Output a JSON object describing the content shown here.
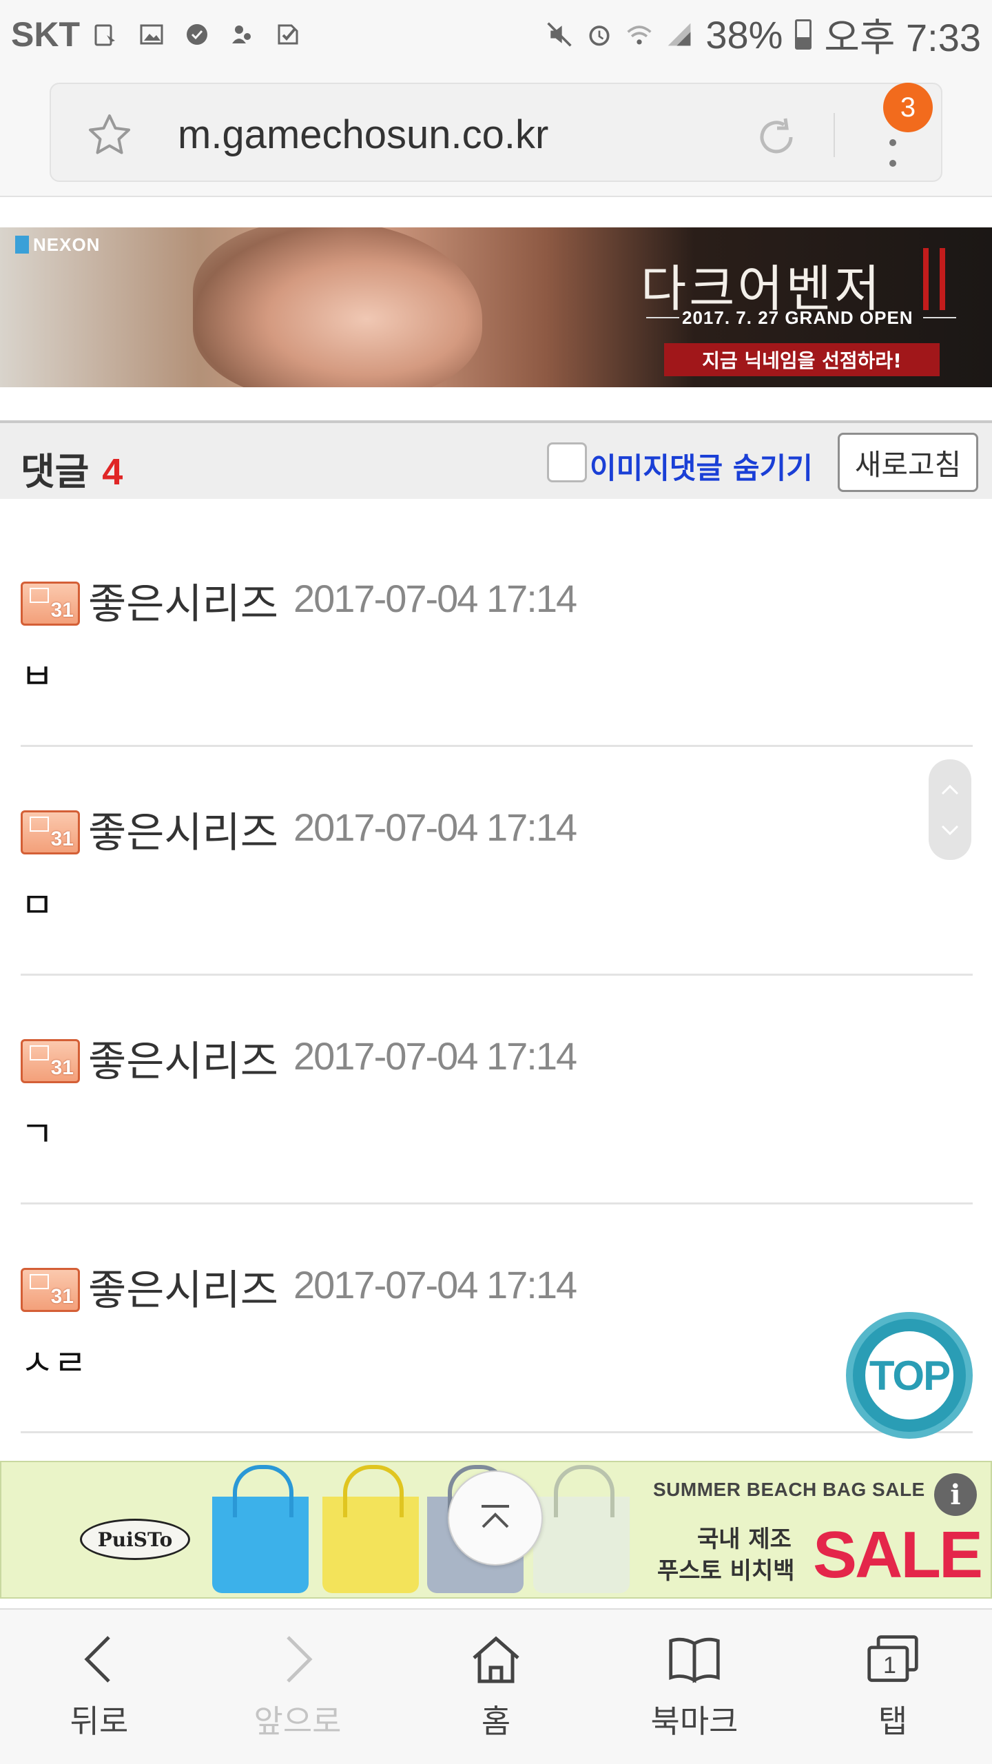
{
  "status_bar": {
    "carrier": "SKT",
    "battery": "38%",
    "time": "오후 7:33"
  },
  "browser": {
    "url": "m.gamechosun.co.kr",
    "tab_badge_count": "3"
  },
  "ad_top": {
    "brand": "NEXON",
    "title": "다크어벤저",
    "date": "2017. 7. 27 GRAND OPEN",
    "cta": "지금 닉네임을 선점하라!"
  },
  "comments_header": {
    "title": "댓글",
    "count": "4",
    "hide_images_label": "이미지댓글 숨기기",
    "hide_images_checked": false,
    "refresh_label": "새로고침"
  },
  "comments": [
    {
      "badge_number": "31",
      "author": "좋은시리즈",
      "datetime": "2017-07-04 17:14",
      "text": "ㅂ"
    },
    {
      "badge_number": "31",
      "author": "좋은시리즈",
      "datetime": "2017-07-04 17:14",
      "text": "ㅁ"
    },
    {
      "badge_number": "31",
      "author": "좋은시리즈",
      "datetime": "2017-07-04 17:14",
      "text": "ㄱ"
    },
    {
      "badge_number": "31",
      "author": "좋은시리즈",
      "datetime": "2017-07-04 17:14",
      "text": "ㅅㄹ"
    }
  ],
  "top_button": {
    "label": "TOP"
  },
  "ad_bottom": {
    "brand": "PuiSTo",
    "headline": "SUMMER BEACH BAG SALE",
    "line1": "국내 제조",
    "line2": "푸스토 비치백",
    "sale": "SALE"
  },
  "bottom_nav": {
    "back": "뒤로",
    "forward": "앞으로",
    "home": "홈",
    "bookmarks": "북마크",
    "tabs": "탭",
    "tabs_count": "1"
  },
  "colors": {
    "accent_blue": "#1a3fd6",
    "count_red": "#e02626",
    "top_button": "#2a9db5",
    "badge_orange": "#f26b1d"
  }
}
